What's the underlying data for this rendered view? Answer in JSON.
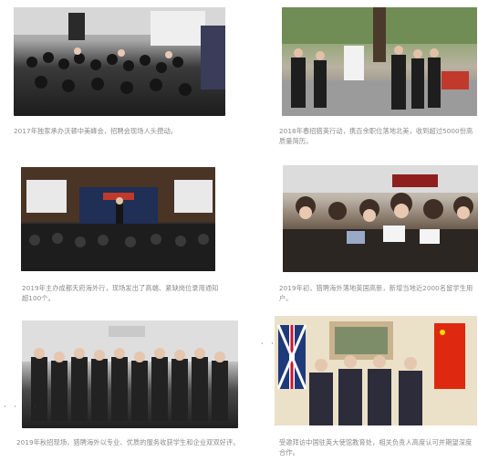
{
  "photos": [
    {
      "name": "photo-crowd-hall",
      "alt": "2017 summit crowd"
    },
    {
      "name": "photo-outdoor-job-fair",
      "alt": "2018 spring outdoor recruiting"
    },
    {
      "name": "photo-stage-talk",
      "alt": "2019 Chengdu presentation"
    },
    {
      "name": "photo-recruitment-crowd",
      "alt": "2019 UK recruitment"
    },
    {
      "name": "photo-group",
      "alt": "2019 group photo"
    },
    {
      "name": "photo-flags-meeting",
      "alt": "Meeting with flags"
    }
  ],
  "captions": {
    "c1": "2017年独家承办沃顿中美峰会，招聘会现场人头攒动。",
    "c2": "2018年春招猎英行动，携百余职位落地北美，收到超过5000份高质量简历。",
    "c3": "2019年主办成都天府海外行，现场发出了高端、紧缺岗位录用通知超100个。",
    "c4": "2019年初，猎聘海外落地英国高新，新增当地近2000名留学生用户。",
    "c5": "2019年秋招现场，猎聘海外以专业、优质的服务收获学生和企业双双好评。",
    "c6": "受邀拜访中国驻英大使馆教育处，相关负责人高度认可并期望深度合作。"
  }
}
